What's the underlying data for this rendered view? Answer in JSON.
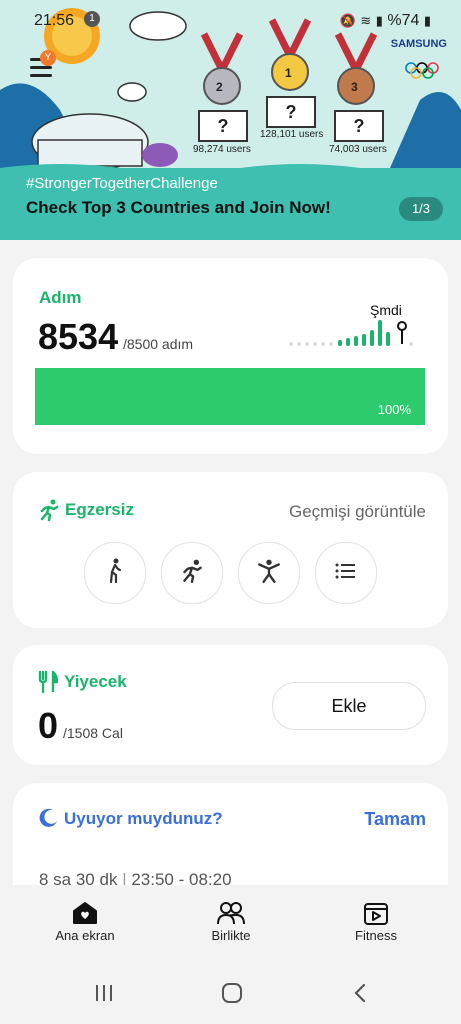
{
  "status_bar": {
    "time": "21:56",
    "notification_count": "1",
    "battery": "%74"
  },
  "banner": {
    "menu_badge": "Y",
    "brand": "SAMSUNG",
    "medals": [
      {
        "rank": "2",
        "box": "?",
        "users": "98,274 users",
        "color": "#b8b8c0"
      },
      {
        "rank": "1",
        "box": "?",
        "users": "128,101 users",
        "color": "#f3c843"
      },
      {
        "rank": "3",
        "box": "?",
        "users": "74,003 users",
        "color": "#c07a4c"
      }
    ],
    "hashtag": "#StrongerTogetherChallenge",
    "headline": "Check Top 3 Countries and Join Now!",
    "pager": "1/3"
  },
  "steps_card": {
    "title": "Adım",
    "value": "8534",
    "goal": "/8500 adım",
    "now_label": "Şmdi",
    "progress_fraction": 1.0,
    "progress_label": "100%"
  },
  "exercise_card": {
    "title": "Egzersiz",
    "history_link": "Geçmişi görüntüle",
    "buttons": [
      "walk-icon",
      "run-icon",
      "workout-icon",
      "list-icon"
    ]
  },
  "food_card": {
    "title": "Yiyecek",
    "value": "0",
    "goal": "/1508 Cal",
    "add_label": "Ekle"
  },
  "sleep_card": {
    "title": "Uyuyor muydunuz?",
    "action": "Tamam",
    "duration": "8 sa 30 dk",
    "range": "23:50 - 08:20"
  },
  "bottom_nav": [
    {
      "label": "Ana ekran",
      "icon": "home-icon"
    },
    {
      "label": "Birlikte",
      "icon": "people-icon"
    },
    {
      "label": "Fitness",
      "icon": "fitness-icon"
    }
  ],
  "colors": {
    "accent_green": "#1ab46c",
    "sleep_blue": "#3a6fd8",
    "banner_teal": "#3ebfb0"
  }
}
